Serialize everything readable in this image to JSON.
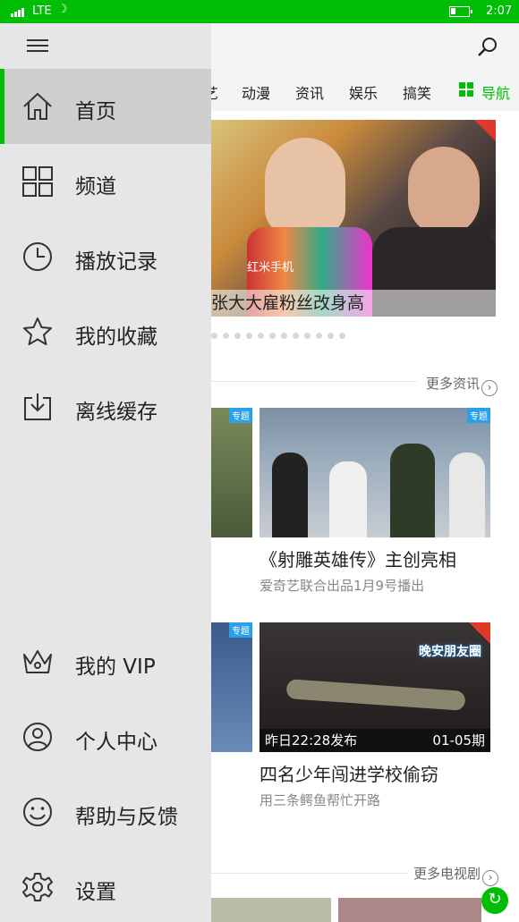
{
  "status_bar": {
    "network": "LTE",
    "time": "2:07",
    "battery_level": 0.3
  },
  "top_categories": [
    "艺",
    "动漫",
    "资讯",
    "娱乐",
    "搞笑"
  ],
  "nav_label": "导航",
  "banner": {
    "caption": "张大大雇粉丝改身高",
    "watermark": "红米手机"
  },
  "sections": {
    "news_more": "更多资讯",
    "tv_more": "更多电视剧"
  },
  "cards": [
    {
      "title": "《射雕英雄传》主创亮相",
      "subtitle": "爱奇艺联合出品1月9号播出",
      "tag": "专题"
    },
    {
      "title": "四名少年闯进学校偷窃",
      "subtitle": "用三条鳄鱼帮忙开路",
      "left_overlay": "昨日22:28发布",
      "right_overlay": "01-05期",
      "logo_text": "晚安朋友圈"
    }
  ],
  "small_tag": "专题",
  "drawer": {
    "items": [
      {
        "label": "首页",
        "icon": "home-icon"
      },
      {
        "label": "频道",
        "icon": "grid-icon"
      },
      {
        "label": "播放记录",
        "icon": "clock-icon"
      },
      {
        "label": "我的收藏",
        "icon": "star-icon"
      },
      {
        "label": "离线缓存",
        "icon": "download-icon"
      }
    ],
    "bottom_items": [
      {
        "label": "我的 VIP",
        "icon": "crown-icon"
      },
      {
        "label": "个人中心",
        "icon": "person-icon"
      },
      {
        "label": "帮助与反馈",
        "icon": "smiley-icon"
      },
      {
        "label": "设置",
        "icon": "gear-icon"
      }
    ]
  },
  "colors": {
    "accent": "#00be06",
    "drawer_bg": "#e6e6e6",
    "active_bg": "#cfcfcf"
  }
}
